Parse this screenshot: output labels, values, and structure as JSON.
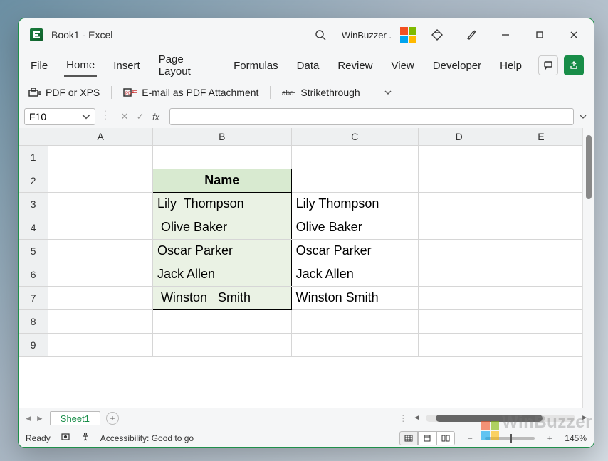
{
  "title": "Book1  -  Excel",
  "brand": "WinBuzzer .",
  "ribbon": {
    "tabs": [
      "File",
      "Home",
      "Insert",
      "Page Layout",
      "Formulas",
      "Data",
      "Review",
      "View",
      "Developer",
      "Help"
    ],
    "active": "Home"
  },
  "qat": {
    "item1": "PDF or XPS",
    "item2": "E-mail as PDF Attachment",
    "item3": "Strikethrough"
  },
  "namebox": "F10",
  "formula": "",
  "columns": [
    "A",
    "B",
    "C",
    "D",
    "E"
  ],
  "rows": [
    "1",
    "2",
    "3",
    "4",
    "5",
    "6",
    "7",
    "8",
    "9"
  ],
  "cells": {
    "B2": "Name",
    "B3": "Lily  Thompson",
    "B4": " Olive Baker",
    "B5": "Oscar Parker",
    "B6": "Jack Allen",
    "B7": " Winston   Smith",
    "C3": "Lily Thompson",
    "C4": "Olive Baker",
    "C5": "Oscar Parker",
    "C6": "Jack Allen",
    "C7": "Winston Smith"
  },
  "sheet": "Sheet1",
  "status": {
    "ready": "Ready",
    "access": "Accessibility: Good to go",
    "zoom": "145%"
  },
  "watermark": "WinBuzzer"
}
